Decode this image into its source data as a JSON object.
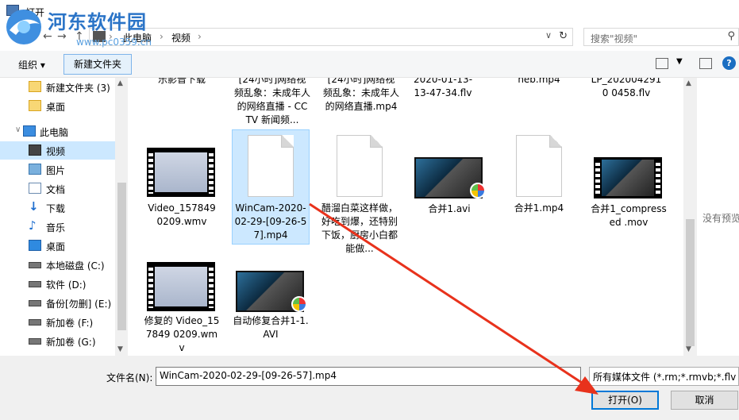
{
  "window": {
    "title": "打开"
  },
  "watermark": {
    "text": "河东软件园",
    "url": "www.pc0359.cn"
  },
  "nav": {
    "back": "←",
    "forward": "→",
    "up": "↑",
    "crumbs": [
      "此电脑",
      "视频"
    ],
    "search_placeholder": "搜索\"视频\""
  },
  "toolbar": {
    "organize": "组织 ▾",
    "new_folder": "新建文件夹"
  },
  "sidebar": {
    "items": [
      {
        "label": "新建文件夹 (3)",
        "icon": "folder-icon"
      },
      {
        "label": "桌面",
        "icon": "folder-icon"
      },
      {
        "label": "此电脑",
        "icon": "pc-icon"
      },
      {
        "label": "视频",
        "icon": "video-icon"
      },
      {
        "label": "图片",
        "icon": "picture-icon"
      },
      {
        "label": "文档",
        "icon": "document-icon"
      },
      {
        "label": "下载",
        "icon": "download-icon"
      },
      {
        "label": "音乐",
        "icon": "music-icon"
      },
      {
        "label": "桌面",
        "icon": "desktop-icon"
      },
      {
        "label": "本地磁盘 (C:)",
        "icon": "drive-icon"
      },
      {
        "label": "软件 (D:)",
        "icon": "drive-icon"
      },
      {
        "label": "备份[勿删] (E:)",
        "icon": "drive-icon"
      },
      {
        "label": "新加卷 (F:)",
        "icon": "drive-icon"
      },
      {
        "label": "新加卷 (G:)",
        "icon": "drive-icon"
      }
    ]
  },
  "files": {
    "row0": [
      {
        "name": "乐影音下载"
      },
      {
        "name": "[24小时]网络视频乱象：未成年人的网络直播 - CCTV 新闻频..."
      },
      {
        "name": "[24小时]网络视频乱象：未成年人的网络直播.mp4"
      },
      {
        "name": "2020-01-13-13-47-34.flv"
      },
      {
        "name": "heb.mp4"
      },
      {
        "name": "LP_2020042910 0458.flv"
      }
    ],
    "row1": [
      {
        "name": "Video_157849 0209.wmv"
      },
      {
        "name": "WinCam-2020-02-29-[09-26-57].mp4"
      },
      {
        "name": "醋溜白菜这样做，好吃到爆，还特别下饭，厨房小白都能做..."
      },
      {
        "name": "合并1.avi"
      },
      {
        "name": "合并1.mp4"
      },
      {
        "name": "合并1_compressed .mov"
      }
    ],
    "row2": [
      {
        "name": "修复的 Video_157849 0209.wmv"
      },
      {
        "name": "自动修复合并1-1.AVI"
      }
    ]
  },
  "preview": {
    "message": "没有预览"
  },
  "bottom": {
    "filename_label": "文件名(N):",
    "filename_value": "WinCam-2020-02-29-[09-26-57].mp4",
    "filter": "所有媒体文件 (*.rm;*.rmvb;*.flv",
    "open": "打开(O)",
    "cancel": "取消"
  },
  "colors": {
    "selection": "#cce8ff",
    "accent": "#0078d7",
    "annotation_arrow": "#e8321c"
  }
}
